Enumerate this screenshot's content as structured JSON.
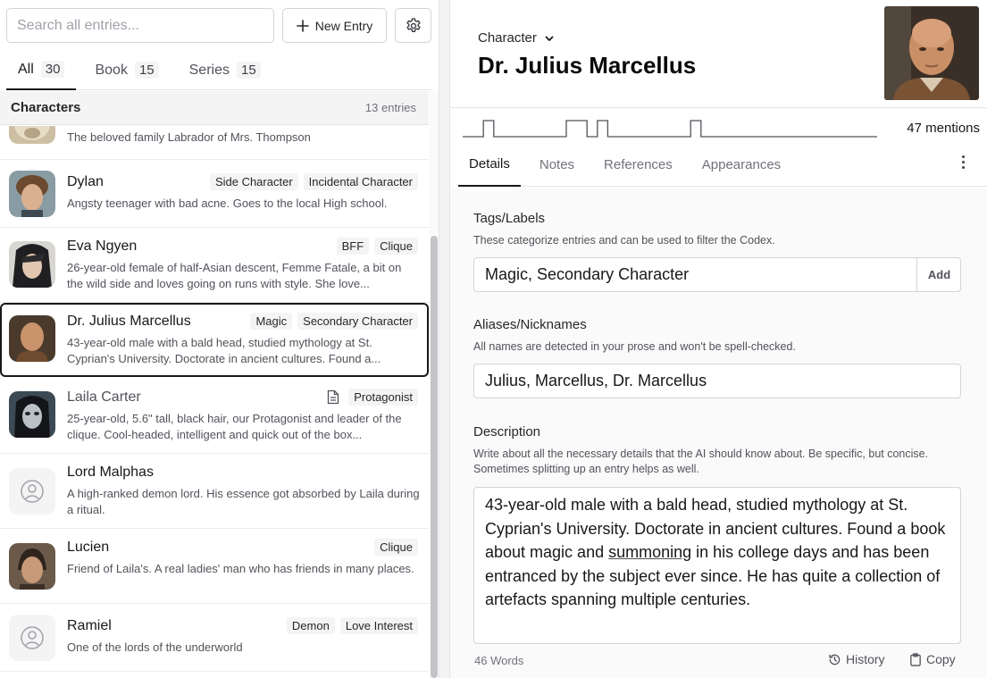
{
  "search": {
    "placeholder": "Search all entries..."
  },
  "toolbar": {
    "new_entry_label": "New Entry"
  },
  "filter_tabs": [
    {
      "label": "All",
      "count": "30"
    },
    {
      "label": "Book",
      "count": "15"
    },
    {
      "label": "Series",
      "count": "15"
    }
  ],
  "list_header": {
    "title": "Characters",
    "count": "13 entries"
  },
  "entries": [
    {
      "name": "",
      "desc": "The beloved family Labrador of Mrs. Thompson",
      "tags": []
    },
    {
      "name": "Dylan",
      "desc": "Angsty teenager with bad acne. Goes to the local High school.",
      "tags": [
        "Side Character",
        "Incidental Character"
      ]
    },
    {
      "name": "Eva Ngyen",
      "desc": "26-year-old female of half-Asian descent, Femme Fatale, a bit on the wild side and loves going on runs with style. She love...",
      "tags": [
        "BFF",
        "Clique"
      ]
    },
    {
      "name": "Dr. Julius Marcellus",
      "desc": "43-year-old male with a bald head, studied mythology at St. Cyprian's University. Doctorate in ancient cultures. Found a...",
      "tags": [
        "Magic",
        "Secondary Character"
      ]
    },
    {
      "name": "Laila Carter",
      "desc": "25-year-old, 5.6\" tall, black hair, our Protagonist and leader of the clique. Cool-headed, intelligent and quick out of the box...",
      "tags": [
        "Protagonist"
      ]
    },
    {
      "name": "Lord Malphas",
      "desc": "A high-ranked demon lord. His essence got absorbed by Laila during a ritual.",
      "tags": []
    },
    {
      "name": "Lucien",
      "desc": "Friend of Laila's. A real ladies' man who has friends in many places.",
      "tags": [
        "Clique"
      ]
    },
    {
      "name": "Ramiel",
      "desc": "One of the lords of the underworld",
      "tags": [
        "Demon",
        "Love Interest"
      ]
    }
  ],
  "detail": {
    "type": "Character",
    "title": "Dr. Julius Marcellus",
    "mentions": "47 mentions",
    "mentions_activity": [
      0,
      0,
      1,
      0,
      0,
      0,
      0,
      0,
      0,
      0,
      1,
      1,
      0,
      1,
      0,
      0,
      0,
      0,
      0,
      0,
      0,
      0,
      1,
      0,
      0,
      0,
      0,
      0,
      0,
      0,
      0,
      0,
      0,
      0,
      0,
      0,
      0,
      0,
      0,
      0
    ],
    "tabs": [
      "Details",
      "Notes",
      "References",
      "Appearances"
    ],
    "tags_label": "Tags/Labels",
    "tags_hint": "These categorize entries and can be used to filter the Codex.",
    "tags_value": "Magic, Secondary Character",
    "add_label": "Add",
    "aliases_label": "Aliases/Nicknames",
    "aliases_hint": "All names are detected in your prose and won't be spell-checked.",
    "aliases_value": "Julius, Marcellus, Dr. Marcellus",
    "description_label": "Description",
    "description_hint": "Write about all the necessary details that the AI should know about. Be specific, but concise. Sometimes splitting up an entry helps as well.",
    "description_pre": "43-year-old male with a bald head, studied mythology at St. Cyprian's University. Doctorate in ancient cultures. Found a book about magic and ",
    "description_flagged": "summoning",
    "description_post": " in his college days and has been entranced by the subject ever since. He has quite a collection of artefacts spanning multiple centuries.",
    "word_count": "46 Words",
    "history_label": "History",
    "copy_label": "Copy"
  },
  "colors": {
    "accent": "#18181b",
    "tag_bg": "#f4f4f5",
    "border": "#d4d4d8"
  }
}
